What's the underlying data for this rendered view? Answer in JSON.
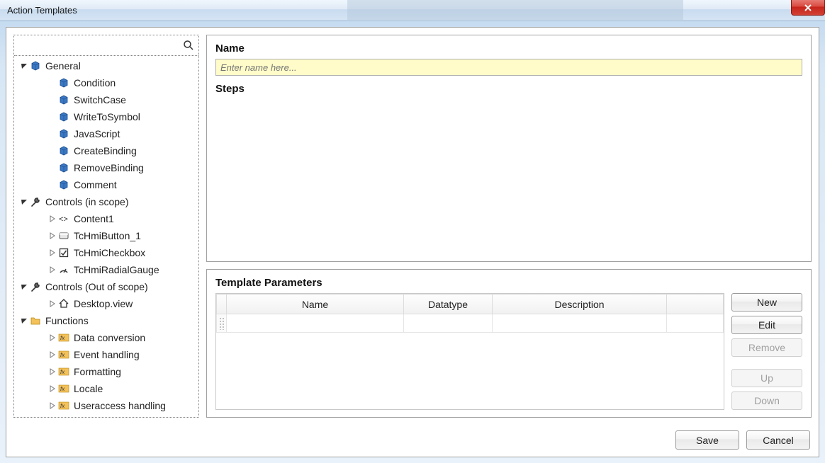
{
  "window": {
    "title": "Action Templates",
    "ghost_label": "Steps"
  },
  "search": {
    "value": "",
    "placeholder": ""
  },
  "tree": {
    "groups": [
      {
        "label": "General",
        "icon": "cube-icon",
        "expanded": true,
        "children": [
          {
            "label": "Condition",
            "icon": "cube-icon",
            "leaf": true
          },
          {
            "label": "SwitchCase",
            "icon": "cube-icon",
            "leaf": true
          },
          {
            "label": "WriteToSymbol",
            "icon": "cube-icon",
            "leaf": true
          },
          {
            "label": "JavaScript",
            "icon": "cube-icon",
            "leaf": true
          },
          {
            "label": "CreateBinding",
            "icon": "cube-icon",
            "leaf": true
          },
          {
            "label": "RemoveBinding",
            "icon": "cube-icon",
            "leaf": true
          },
          {
            "label": "Comment",
            "icon": "cube-icon",
            "leaf": true
          }
        ]
      },
      {
        "label": "Controls (in scope)",
        "icon": "wrench-icon",
        "expanded": true,
        "children": [
          {
            "label": "Content1",
            "icon": "tag-icon",
            "leaf": false
          },
          {
            "label": "TcHmiButton_1",
            "icon": "button-icon",
            "leaf": false
          },
          {
            "label": "TcHmiCheckbox",
            "icon": "checkbox-icon",
            "leaf": false
          },
          {
            "label": "TcHmiRadialGauge",
            "icon": "gauge-icon",
            "leaf": false
          }
        ]
      },
      {
        "label": "Controls (Out of scope)",
        "icon": "wrench-icon",
        "expanded": true,
        "children": [
          {
            "label": "Desktop.view",
            "icon": "home-icon",
            "leaf": false
          }
        ]
      },
      {
        "label": "Functions",
        "icon": "folder-icon",
        "expanded": true,
        "children": [
          {
            "label": "Data conversion",
            "icon": "fx-icon",
            "leaf": false
          },
          {
            "label": "Event handling",
            "icon": "fx-icon",
            "leaf": false
          },
          {
            "label": "Formatting",
            "icon": "fx-icon",
            "leaf": false
          },
          {
            "label": "Locale",
            "icon": "fx-icon",
            "leaf": false
          },
          {
            "label": "Useraccess handling",
            "icon": "fx-icon",
            "leaf": false
          }
        ]
      }
    ]
  },
  "form": {
    "name_label": "Name",
    "name_placeholder": "Enter name here...",
    "name_value": "",
    "steps_label": "Steps"
  },
  "params": {
    "title": "Template Parameters",
    "columns": {
      "name": "Name",
      "datatype": "Datatype",
      "description": "Description"
    },
    "rows": [
      {
        "name": "",
        "datatype": "",
        "description": ""
      }
    ],
    "buttons": {
      "new": "New",
      "edit": "Edit",
      "remove": "Remove",
      "up": "Up",
      "down": "Down"
    },
    "enabled": {
      "new": true,
      "edit": true,
      "remove": false,
      "up": false,
      "down": false
    }
  },
  "footer": {
    "save": "Save",
    "cancel": "Cancel"
  }
}
